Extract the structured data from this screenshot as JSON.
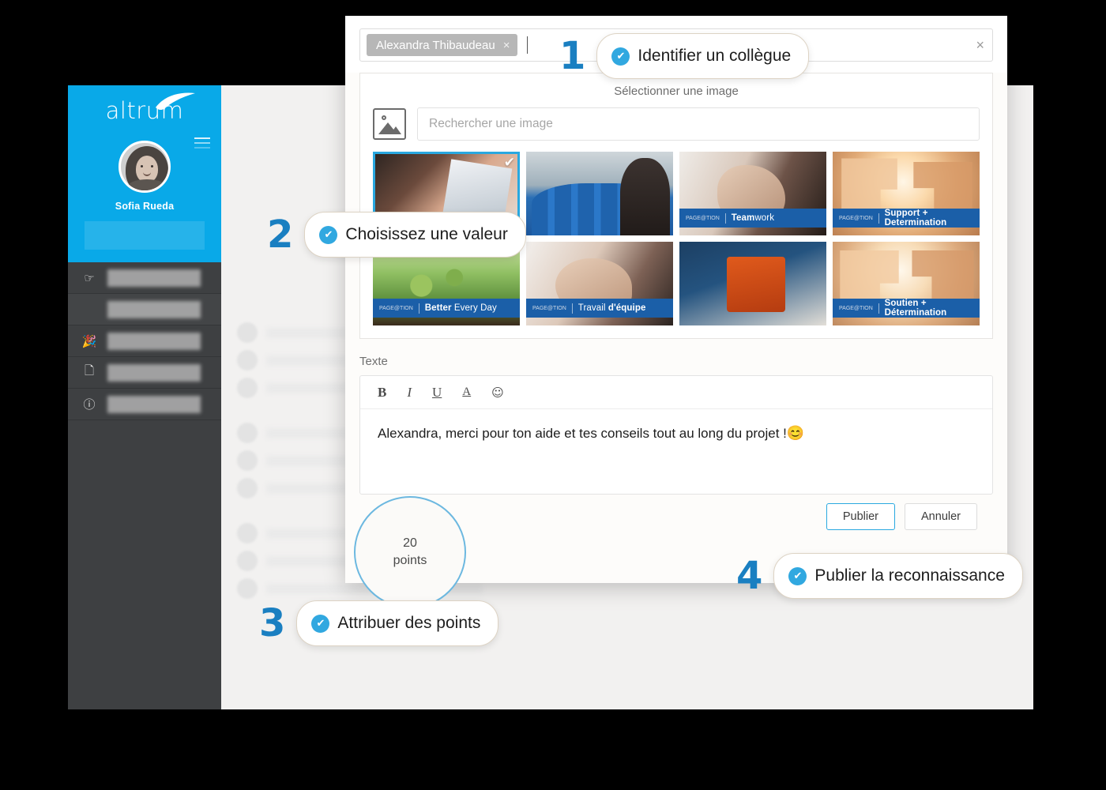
{
  "app": {
    "sidebar": {
      "brand": "altrum",
      "user_name": "Sofia Rueda",
      "menu_icons": [
        "hand-pointer-icon",
        "blank-icon",
        "party-popper-icon",
        "news-card-icon",
        "question-mark-icon"
      ]
    }
  },
  "modal": {
    "close_label": "×",
    "recipient_chip": {
      "name": "Alexandra Thibaudeau",
      "remove_label": "×"
    },
    "picker": {
      "title": "Sélectionner une image",
      "search_placeholder": "Rechercher une image",
      "image_icon": "picture-icon",
      "images": [
        {
          "caption_brand": "",
          "caption_light": "",
          "caption_bold": "",
          "selected": true,
          "check": "✔"
        },
        {
          "caption_brand": "",
          "caption_light": "",
          "caption_bold": "",
          "selected": false,
          "check": ""
        },
        {
          "caption_brand": "PAGE@TION",
          "caption_bold": "Team",
          "caption_light": "work",
          "selected": false,
          "check": ""
        },
        {
          "caption_brand": "PAGE@TION",
          "caption_bold": "Support + Determination",
          "caption_light": "",
          "selected": false,
          "check": ""
        },
        {
          "caption_brand": "PAGE@TION",
          "caption_bold": "Better",
          "caption_light": " Every Day",
          "selected": false,
          "check": ""
        },
        {
          "caption_brand": "PAGE@TION",
          "caption_bold": "",
          "caption_light": "Travail ",
          "caption_bold2": "d'équipe",
          "selected": false,
          "check": ""
        },
        {
          "caption_brand": "",
          "caption_light": "",
          "caption_bold": "",
          "selected": false,
          "check": ""
        },
        {
          "caption_brand": "PAGE@TION",
          "caption_bold": "Soutien + Détermination",
          "caption_light": "",
          "selected": false,
          "check": ""
        }
      ]
    },
    "editor": {
      "label": "Texte",
      "toolbar": {
        "bold": "B",
        "italic": "I",
        "underline": "U",
        "font_color": "A",
        "emoji": "☺"
      },
      "message": "Alexandra,  merci pour ton aide et tes conseils tout au long du projet !",
      "message_emoji": "😊",
      "publish_label": "Publier",
      "cancel_label": "Annuler"
    },
    "points": {
      "value": "20",
      "unit": "points"
    }
  },
  "callouts": [
    {
      "number": "1",
      "label": "Identifier un collègue",
      "check": "✔"
    },
    {
      "number": "2",
      "label": "Choisissez une valeur",
      "check": "✔"
    },
    {
      "number": "3",
      "label": "Attribuer des points",
      "check": "✔"
    },
    {
      "number": "4",
      "label": "Publier la reconnaissance",
      "check": "✔"
    }
  ],
  "colors": {
    "brand_blue": "#09a9e8",
    "accent_blue": "#29a8e0",
    "callout_number": "#1a7fc1",
    "sidebar_dark": "#3e4042",
    "caption_blue": "#1b5fa8"
  }
}
